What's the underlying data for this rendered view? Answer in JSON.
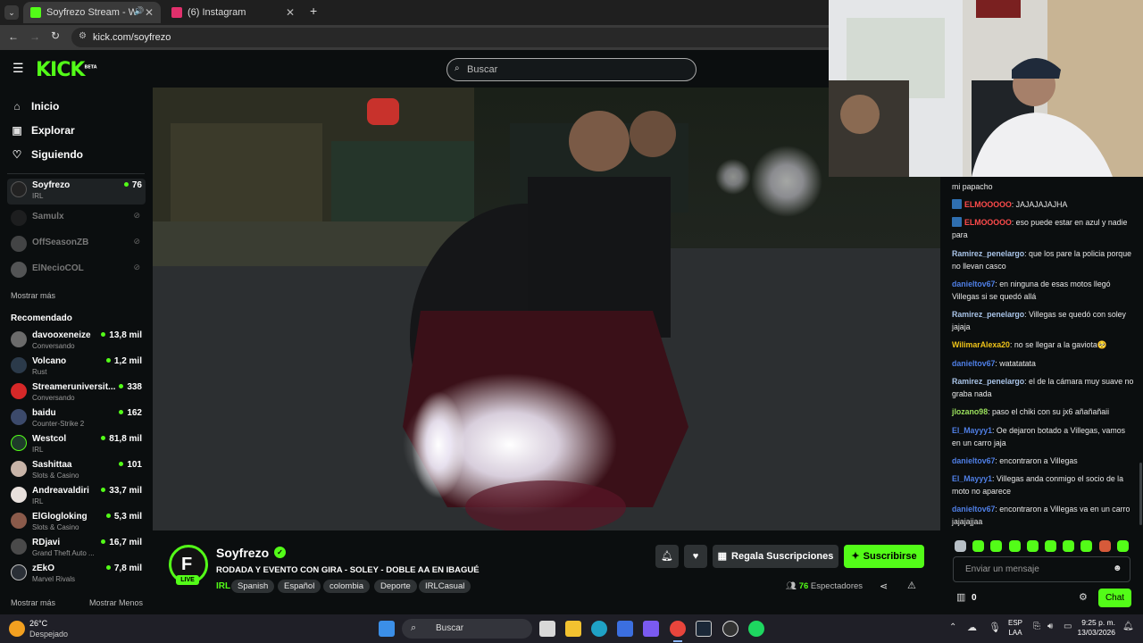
{
  "browser": {
    "tabs": [
      {
        "title": "Soyfrezo Stream - Watch Li",
        "active": true,
        "icon": "kick-favicon"
      },
      {
        "title": "(6) Instagram",
        "active": false,
        "icon": "instagram-favicon"
      }
    ],
    "new_tab": "+",
    "url": "kick.com/soyfrezo"
  },
  "header": {
    "logo": "KICK",
    "logo_badge": "BETA",
    "search_placeholder": "Buscar"
  },
  "sidebar": {
    "nav": [
      {
        "label": "Inicio",
        "icon": "home-icon"
      },
      {
        "label": "Explorar",
        "icon": "compass-icon"
      },
      {
        "label": "Siguiendo",
        "icon": "heart-icon"
      }
    ],
    "following": [
      {
        "name": "Soyfrezo",
        "category": "IRL",
        "viewers": "76",
        "live": true
      },
      {
        "name": "Samulx",
        "live": false
      },
      {
        "name": "OffSeasonZB",
        "live": false
      },
      {
        "name": "ElNecioCOL",
        "live": false
      }
    ],
    "show_more": "Mostrar más",
    "recommended_title": "Recomendado",
    "recommended": [
      {
        "name": "davooxeneize",
        "category": "Conversando",
        "viewers": "13,8 mil"
      },
      {
        "name": "Volcano",
        "category": "Rust",
        "viewers": "1,2 mil"
      },
      {
        "name": "Streameruniversit...",
        "category": "Conversando",
        "viewers": "338"
      },
      {
        "name": "baidu",
        "category": "Counter-Strike 2",
        "viewers": "162"
      },
      {
        "name": "Westcol",
        "category": "IRL",
        "viewers": "81,8 mil"
      },
      {
        "name": "Sashittaa",
        "category": "Slots & Casino",
        "viewers": "101"
      },
      {
        "name": "Andreavaldiri",
        "category": "IRL",
        "viewers": "33,7 mil"
      },
      {
        "name": "ElGlogloking",
        "category": "Slots & Casino",
        "viewers": "5,3 mil"
      },
      {
        "name": "RDjavi",
        "category": "Grand Theft Auto ...",
        "viewers": "16,7 mil"
      },
      {
        "name": "zEkO",
        "category": "Marvel Rivals",
        "viewers": "7,8 mil"
      }
    ],
    "show_more_2": "Mostrar más",
    "show_less": "Mostrar Menos"
  },
  "stream": {
    "streamer": "Soyfrezo",
    "live_label": "LIVE",
    "title": "RODADA Y EVENTO CON GIRA - SOLEY - DOBLE AA EN IBAGUÉ",
    "category": "IRL",
    "tags": [
      "Spanish",
      "Español",
      "colombia",
      "Deporte",
      "IRLCasual"
    ],
    "gift_label": "Regala Suscripciones",
    "subscribe_label": "Suscribirse",
    "viewers_count": "76",
    "viewers_label": "Espectadores"
  },
  "chat": {
    "messages": [
      {
        "user": "",
        "text": "mi papacho",
        "color": "#e8e8e8"
      },
      {
        "user": "ELMOOOOO",
        "text": ": JAJAJAJAJHA",
        "color": "#ff4b4b",
        "badge": true
      },
      {
        "user": "ELMOOOOO",
        "text": ": eso puede estar en azul y nadie para",
        "color": "#ff4b4b",
        "badge": true
      },
      {
        "user": "Ramirez_penelargo",
        "text": ": que los pare la policia porque no llevan casco",
        "color": "#a9c4e8"
      },
      {
        "user": "danieltov67",
        "text": ": en ninguna de esas motos llegó Villegas si se quedó allá",
        "color": "#4f7fe6"
      },
      {
        "user": "Ramirez_penelargo",
        "text": ": Villegas se quedó con soley jajaja",
        "color": "#a9c4e8"
      },
      {
        "user": "WilimarAlexa20",
        "text": ": no se llegar a la gaviota🥺",
        "color": "#f0c419"
      },
      {
        "user": "danieltov67",
        "text": ": watatatata",
        "color": "#4f7fe6"
      },
      {
        "user": "Ramirez_penelargo",
        "text": ": el de la cámara muy suave no graba nada",
        "color": "#a9c4e8"
      },
      {
        "user": "jlozano98",
        "text": ": paso el chiki con su jx6 añañañaii",
        "color": "#9be15d"
      },
      {
        "user": "El_Mayyy1",
        "text": ": Oe dejaron botado a Villegas, vamos en un carro jaja",
        "color": "#4f7fe6"
      },
      {
        "user": "danieltov67",
        "text": ": encontraron a Villegas",
        "color": "#4f7fe6"
      },
      {
        "user": "El_Mayyy1",
        "text": ": Villegas anda conmigo el socio de la moto no aparece",
        "color": "#4f7fe6"
      },
      {
        "user": "danieltov67",
        "text": ": encontraron a Villegas va en un carro jajajajjaa",
        "color": "#4f7fe6"
      }
    ],
    "input_placeholder": "Enviar un mensaje",
    "points": "0",
    "send_label": "Chat"
  },
  "taskbar": {
    "weather_temp": "26°C",
    "weather_desc": "Despejado",
    "search_label": "Buscar",
    "lang": "ESP",
    "lang_sub": "LAA",
    "time": "9:25 p. m.",
    "date": "13/03/2026"
  },
  "colors": {
    "accent": "#53fc18",
    "background": "#0b0e0f",
    "button": "#2e3234"
  }
}
